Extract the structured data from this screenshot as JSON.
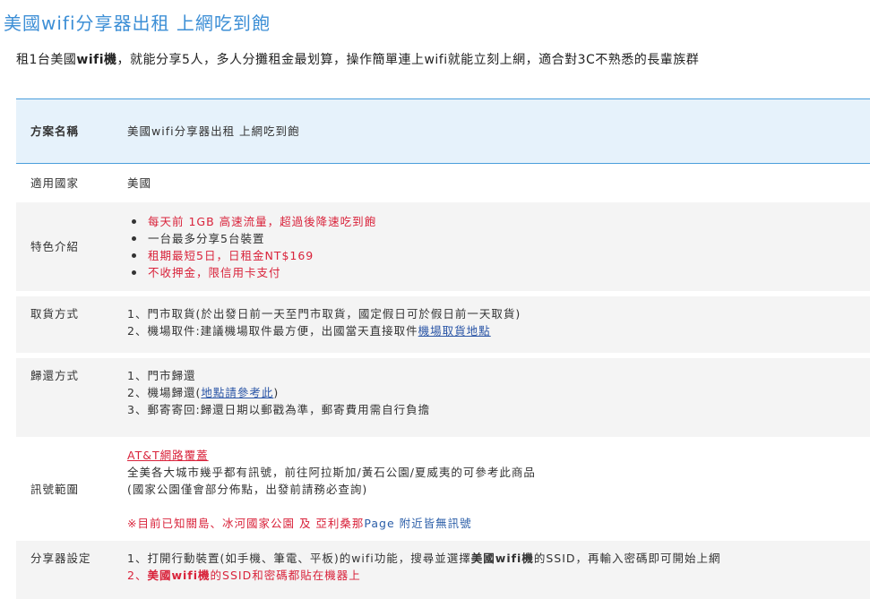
{
  "page": {
    "title": "美國wifi分享器出租 上網吃到飽",
    "intro_prefix": "租1台美國",
    "intro_bold": "wifi機",
    "intro_suffix": "，就能分享5人，多人分攤租金最划算，操作簡單連上wifi就能立刻上網，適合對3C不熟悉的長輩族群"
  },
  "table": {
    "plan_name_label": "方案名稱",
    "plan_name_value": "美國wifi分享器出租 上網吃到飽",
    "country_label": "適用國家",
    "country_value": "美國",
    "features_label": "特色介紹",
    "features": [
      {
        "text": "每天前 1GB 高速流量，超過後降速吃到飽",
        "color": "#d9233b"
      },
      {
        "text": "一台最多分享5台裝置",
        "color": "#333333"
      },
      {
        "text": "租期最短5日，日租金NT$169",
        "color": "#d9233b"
      },
      {
        "text": "不收押金，限信用卡支付",
        "color": "#d9233b"
      }
    ],
    "pickup_label": "取貨方式",
    "pickup_line1": "1、門市取貨(於出發日前一天至門市取貨，國定假日可於假日前一天取貨)",
    "pickup_line2_prefix": "2、機場取件:建議機場取件最方便，出國當天直接取件",
    "pickup_line2_link": "機場取貨地點",
    "return_label": "歸還方式",
    "return_line1": "1、門市歸還",
    "return_line2_prefix": "2、機場歸還(",
    "return_line2_link": "地點請參考此",
    "return_line2_suffix": ")",
    "return_line3": "3、郵寄寄回:歸還日期以郵戳為準，郵寄費用需自行負擔",
    "signal_label": "訊號範圍",
    "signal_link": "AT&T網路覆蓋",
    "signal_line1": "全美各大城市幾乎都有訊號，前往阿拉斯加/黃石公園/夏威夷的可參考此商品",
    "signal_line2": "(國家公園僅會部分佈點，出發前請務必查詢)",
    "signal_note_prefix": "※目前已知關島、冰河國家公園 及 亞利桑那",
    "signal_note_suffix": "Page 附近皆無訊號",
    "setup_label": "分享器設定",
    "setup_line1_prefix": "1、打開行動裝置(如手機、筆電、平板)的wifi功能，搜尋並選擇",
    "setup_line1_bold": "美國wifi機",
    "setup_line1_suffix": "的SSID，再輸入密碼即可開始上網",
    "setup_line2_prefix": "2、",
    "setup_line2_bold": "美國wifi機",
    "setup_line2_suffix": "的SSID和密碼都貼在機器上"
  },
  "colors": {
    "title_blue": "#3d8fd6",
    "header_bg": "#e6f2fb",
    "header_border": "#4a9edc",
    "row_grey": "#f4f4f4",
    "highlight_red": "#d9233b",
    "note_blue": "#2b5ea8",
    "link_blue": "#2a55a6"
  }
}
